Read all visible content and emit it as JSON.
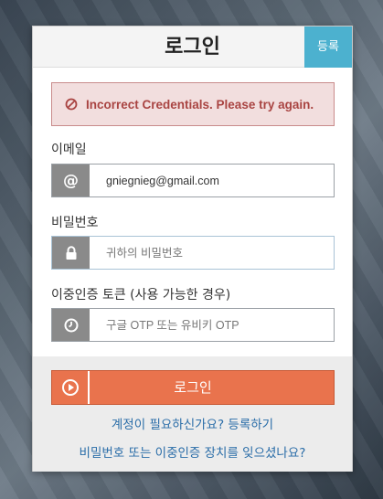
{
  "header": {
    "title": "로그인",
    "register_label": "등록"
  },
  "alert": {
    "message": "Incorrect Credentials. Please try again.",
    "icon": "ban-icon"
  },
  "form": {
    "email": {
      "label": "이메일",
      "value": "gniegnieg@gmail.com",
      "icon": "at-icon"
    },
    "password": {
      "label": "비밀번호",
      "placeholder": "귀하의 비밀번호",
      "icon": "lock-icon"
    },
    "twofactor": {
      "label": "이중인증 토큰 (사용 가능한 경우)",
      "placeholder": "구글 OTP 또는 유비키 OTP",
      "icon": "clock-icon"
    }
  },
  "footer": {
    "login_label": "로그인",
    "login_icon": "play-circle-icon",
    "need_account_link": "계정이 필요하신가요? 등록하기",
    "forgot_link": "비밀번호 또는 이중인증 장치를 잊으셨나요?"
  },
  "colors": {
    "register_tab": "#4cb1cf",
    "alert_bg": "#f2dede",
    "alert_text": "#a94442",
    "login_button": "#e9734d",
    "link": "#2a6da8"
  }
}
